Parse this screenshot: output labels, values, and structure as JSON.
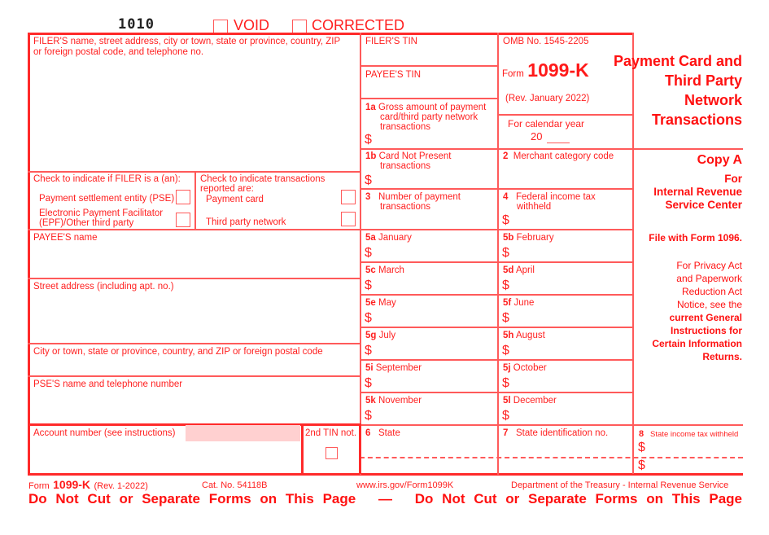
{
  "header": {
    "form_code": "1010",
    "void_label": "VOID",
    "corrected_label": "CORRECTED"
  },
  "filer": {
    "name_label_line1": "FILER'S name, street address, city or town, state or province, country, ZIP",
    "name_label_line2": "or foreign postal code, and telephone no.",
    "tin_label": "FILER'S TIN",
    "check_filer_label": "Check to indicate if FILER is a (an):",
    "pse_label": "Payment settlement entity (PSE)",
    "epf_label_line1": "Electronic Payment Facilitator",
    "epf_label_line2": "(EPF)/Other third party",
    "check_tx_label_line1": "Check to indicate transactions",
    "check_tx_label_line2": "reported are:",
    "payment_card_label": "Payment card",
    "third_party_label": "Third party network"
  },
  "payee": {
    "tin_label": "PAYEE'S TIN",
    "name_label": "PAYEE'S name",
    "street_label": "Street address (including apt. no.)",
    "city_label": "City or town, state or province, country, and ZIP or foreign postal code",
    "pse_name_label": "PSE'S name and telephone number",
    "account_label": "Account number (see instructions)",
    "second_tin_label": "2nd TIN not."
  },
  "form_info": {
    "omb": "OMB No. 1545-2205",
    "form_word": "Form",
    "form_number": "1099-K",
    "rev": "(Rev. January 2022)",
    "calendar_label": "For calendar year",
    "calendar_prefix": "20",
    "title_lines": [
      "Payment Card and",
      "Third Party",
      "Network",
      "Transactions"
    ]
  },
  "boxes": {
    "b1a_num": "1a",
    "b1a_line1": "Gross amount of payment",
    "b1a_line2": "card/third party network",
    "b1a_line3": "transactions",
    "b1b_num": "1b",
    "b1b_line1": "Card Not Present",
    "b1b_line2": "transactions",
    "b2_num": "2",
    "b2_label": "Merchant category code",
    "b3_num": "3",
    "b3_line1": "Number of payment",
    "b3_line2": "transactions",
    "b4_num": "4",
    "b4_line1": "Federal income tax",
    "b4_line2": "withheld",
    "months": [
      {
        "num": "5a",
        "label": "January"
      },
      {
        "num": "5b",
        "label": "February"
      },
      {
        "num": "5c",
        "label": "March"
      },
      {
        "num": "5d",
        "label": "April"
      },
      {
        "num": "5e",
        "label": "May"
      },
      {
        "num": "5f",
        "label": "June"
      },
      {
        "num": "5g",
        "label": "July"
      },
      {
        "num": "5h",
        "label": "August"
      },
      {
        "num": "5i",
        "label": "September"
      },
      {
        "num": "5j",
        "label": "October"
      },
      {
        "num": "5k",
        "label": "November"
      },
      {
        "num": "5l",
        "label": "December"
      }
    ],
    "b6_num": "6",
    "b6_label": "State",
    "b7_num": "7",
    "b7_label": "State identification no.",
    "b8_num": "8",
    "b8_label": "State income tax withheld",
    "dollar": "$"
  },
  "copy": {
    "title": "Copy A",
    "for_line1": "For",
    "for_line2": "Internal Revenue",
    "for_line3": "Service Center",
    "file_with": "File with Form 1096.",
    "privacy_lines": [
      "For Privacy Act",
      "and Paperwork",
      "Reduction Act",
      "Notice, see the"
    ],
    "privacy_bold_lines": [
      "current General",
      "Instructions for",
      "Certain Information",
      "Returns."
    ]
  },
  "footer": {
    "form_word": "Form",
    "form_number": "1099-K",
    "rev": "(Rev. 1-2022)",
    "cat_no": "Cat. No. 54118B",
    "url": "www.irs.gov/Form1099K",
    "dept": "Department of the Treasury - Internal Revenue Service",
    "warning": "Do Not Cut or Separate Forms on This Page",
    "dash": "—"
  }
}
